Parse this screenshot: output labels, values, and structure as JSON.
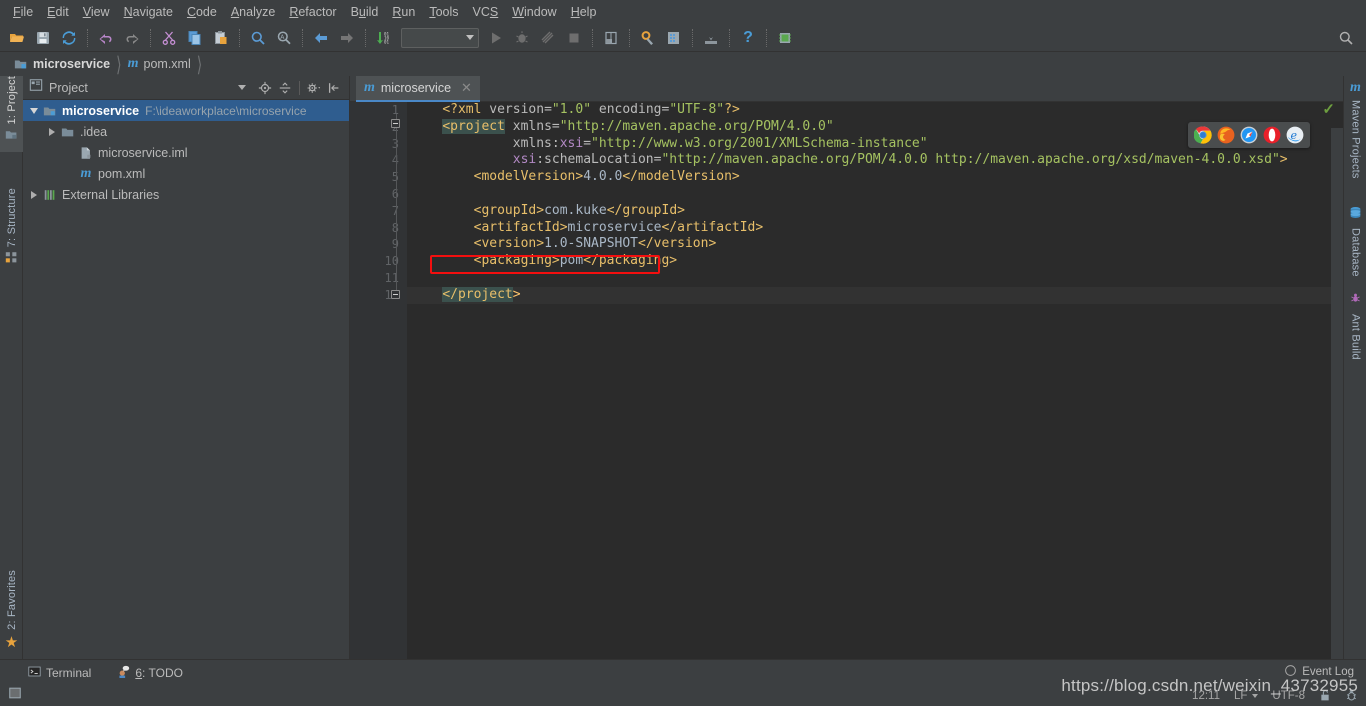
{
  "menubar": {
    "items": [
      {
        "label": "File",
        "mnemonic": "F"
      },
      {
        "label": "Edit",
        "mnemonic": "E"
      },
      {
        "label": "View",
        "mnemonic": "V"
      },
      {
        "label": "Navigate",
        "mnemonic": "N"
      },
      {
        "label": "Code",
        "mnemonic": "C"
      },
      {
        "label": "Analyze",
        "mnemonic": "A"
      },
      {
        "label": "Refactor",
        "mnemonic": "R"
      },
      {
        "label": "Build",
        "mnemonic": "u"
      },
      {
        "label": "Run",
        "mnemonic": "R"
      },
      {
        "label": "Tools",
        "mnemonic": "T"
      },
      {
        "label": "VCS",
        "mnemonic": "S"
      },
      {
        "label": "Window",
        "mnemonic": "W"
      },
      {
        "label": "Help",
        "mnemonic": "H"
      }
    ]
  },
  "toolbar": {
    "icons": [
      "open-folder-icon",
      "save-all-icon",
      "sync-refresh-icon",
      "undo-icon",
      "redo-icon",
      "cut-icon",
      "copy-icon",
      "paste-icon",
      "find-icon",
      "replace-icon",
      "back-icon",
      "forward-icon",
      "compile-icon"
    ],
    "run_config_value": "",
    "run_config_placeholder": "",
    "right_icons": [
      "run-icon",
      "debug-icon",
      "run-coverage-icon",
      "stop-icon",
      "project-structure-icon",
      "settings-icon",
      "maven-icon",
      "update-project-icon",
      "help-icon",
      "device-manager-icon"
    ],
    "search_icon": "search-everywhere-icon"
  },
  "navbar": {
    "crumbs": [
      {
        "label": "microservice",
        "icon": "module-icon"
      },
      {
        "label": "pom.xml",
        "icon": "maven-m-icon"
      }
    ]
  },
  "left_rail": {
    "items": [
      {
        "label": "1: Project",
        "mnemonic": "1",
        "icon": "project-icon",
        "active": true
      },
      {
        "label": "7: Structure",
        "mnemonic": "7",
        "icon": "structure-icon",
        "active": false
      }
    ],
    "bottom_items": [
      {
        "label": "2: Favorites",
        "mnemonic": "2",
        "icon": "star-icon",
        "active": false
      }
    ]
  },
  "right_rail": {
    "items": [
      {
        "label": "Maven Projects",
        "icon": "maven-m-icon"
      },
      {
        "label": "Database",
        "icon": "database-icon"
      },
      {
        "label": "Ant Build",
        "icon": "ant-icon"
      }
    ]
  },
  "project_panel": {
    "title": "Project",
    "view_icon": "project-view-icon",
    "tools": [
      "locate-target-icon",
      "collapse-all-icon",
      "settings-gear-icon",
      "hide-panel-icon"
    ],
    "tree": [
      {
        "label": "microservice",
        "sublabel": "F:\\ideaworkplace\\microservice",
        "icon": "module-icon",
        "expanded": true,
        "indent": 0,
        "bold": true,
        "selected": true,
        "has_arrow": true
      },
      {
        "label": ".idea",
        "sublabel": "",
        "icon": "folder-icon",
        "expanded": false,
        "indent": 1,
        "bold": false,
        "selected": false,
        "has_arrow": true
      },
      {
        "label": "microservice.iml",
        "sublabel": "",
        "icon": "iml-file-icon",
        "expanded": false,
        "indent": 2,
        "bold": false,
        "selected": false,
        "has_arrow": false
      },
      {
        "label": "pom.xml",
        "sublabel": "",
        "icon": "maven-m-icon",
        "expanded": false,
        "indent": 2,
        "bold": false,
        "selected": false,
        "has_arrow": false
      },
      {
        "label": "External Libraries",
        "sublabel": "",
        "icon": "libraries-icon",
        "expanded": false,
        "indent": 0,
        "bold": false,
        "selected": false,
        "has_arrow": true
      }
    ]
  },
  "editor": {
    "tab": {
      "label": "microservice",
      "icon": "maven-m-icon",
      "close_icon": "close-icon"
    },
    "inspection_status": "ok-check-icon",
    "line_count": 12,
    "lines": [
      {
        "n": 1,
        "segments": [
          {
            "t": "    ",
            "c": "tk-text"
          },
          {
            "t": "<?xml ",
            "c": "tk-pi"
          },
          {
            "t": "version=",
            "c": "tk-attr"
          },
          {
            "t": "\"1.0\"",
            "c": "tk-val"
          },
          {
            "t": " encoding=",
            "c": "tk-attr"
          },
          {
            "t": "\"UTF-8\"",
            "c": "tk-val"
          },
          {
            "t": "?>",
            "c": "tk-pi"
          }
        ]
      },
      {
        "n": 2,
        "segments": [
          {
            "t": "    ",
            "c": "tk-text"
          },
          {
            "t": "<project",
            "c": "tk-tag tk-hl"
          },
          {
            "t": " xmlns=",
            "c": "tk-attr"
          },
          {
            "t": "\"http://maven.apache.org/POM/4.0.0\"",
            "c": "tk-val"
          }
        ]
      },
      {
        "n": 3,
        "segments": [
          {
            "t": "             ",
            "c": "tk-text"
          },
          {
            "t": "xmlns:",
            "c": "tk-attr"
          },
          {
            "t": "xsi",
            "c": "tk-ns"
          },
          {
            "t": "=",
            "c": "tk-attr"
          },
          {
            "t": "\"http://www.w3.org/2001/XMLSchema-instance\"",
            "c": "tk-val"
          }
        ]
      },
      {
        "n": 4,
        "segments": [
          {
            "t": "             ",
            "c": "tk-text"
          },
          {
            "t": "xsi",
            "c": "tk-ns"
          },
          {
            "t": ":schemaLocation=",
            "c": "tk-attr"
          },
          {
            "t": "\"http://maven.apache.org/POM/4.0.0 http://maven.apache.org/xsd/maven-4.0.0.xsd\"",
            "c": "tk-val"
          },
          {
            "t": ">",
            "c": "tk-tag"
          }
        ]
      },
      {
        "n": 5,
        "segments": [
          {
            "t": "        ",
            "c": "tk-text"
          },
          {
            "t": "<modelVersion>",
            "c": "tk-tag"
          },
          {
            "t": "4.0.0",
            "c": "tk-text"
          },
          {
            "t": "</modelVersion>",
            "c": "tk-tag"
          }
        ]
      },
      {
        "n": 6,
        "segments": []
      },
      {
        "n": 7,
        "segments": [
          {
            "t": "        ",
            "c": "tk-text"
          },
          {
            "t": "<groupId>",
            "c": "tk-tag"
          },
          {
            "t": "com.kuke",
            "c": "tk-text"
          },
          {
            "t": "</groupId>",
            "c": "tk-tag"
          }
        ]
      },
      {
        "n": 8,
        "segments": [
          {
            "t": "        ",
            "c": "tk-text"
          },
          {
            "t": "<artifactId>",
            "c": "tk-tag"
          },
          {
            "t": "microservice",
            "c": "tk-text"
          },
          {
            "t": "</artifactId>",
            "c": "tk-tag"
          }
        ]
      },
      {
        "n": 9,
        "segments": [
          {
            "t": "        ",
            "c": "tk-text"
          },
          {
            "t": "<version>",
            "c": "tk-tag"
          },
          {
            "t": "1.0-SNAPSHOT",
            "c": "tk-text"
          },
          {
            "t": "</version>",
            "c": "tk-tag"
          }
        ]
      },
      {
        "n": 10,
        "segments": [
          {
            "t": "        ",
            "c": "tk-text"
          },
          {
            "t": "<packaging>",
            "c": "tk-tag"
          },
          {
            "t": "pom",
            "c": "tk-text"
          },
          {
            "t": "</packaging>",
            "c": "tk-tag"
          }
        ]
      },
      {
        "n": 11,
        "segments": []
      },
      {
        "n": 12,
        "segments": [
          {
            "t": "    ",
            "c": "tk-text"
          },
          {
            "t": "</project",
            "c": "tk-tag tk-hl"
          },
          {
            "t": ">",
            "c": "tk-brace"
          }
        ]
      }
    ],
    "annotation": {
      "type": "red-rectangle",
      "target_line": 10,
      "color": "#f40f0f"
    },
    "browser_popup": {
      "browsers": [
        "chrome-icon",
        "firefox-icon",
        "safari-icon",
        "opera-icon",
        "ie-icon"
      ]
    }
  },
  "bottom_bar": {
    "items": [
      {
        "label": "Terminal",
        "mnemonic": "",
        "icon": "terminal-icon"
      },
      {
        "label": "6: TODO",
        "mnemonic": "6",
        "icon": "todo-icon"
      }
    ]
  },
  "status_bar": {
    "left_icon": "toggle-toolbar-icon",
    "event_log": {
      "label": "Event Log",
      "icon": "event-log-icon"
    },
    "caret_position": "12:11",
    "line_separator": "LF",
    "encoding": "UTF-8",
    "lock_icon": "unlock-icon",
    "inspection_icon": "inspection-profile-icon",
    "watermark": "https://blog.csdn.net/weixin_43732955"
  },
  "colors": {
    "accent": "#4a88c7",
    "selection": "#2f5d8f",
    "annotation_red": "#f40f0f",
    "editor_bg": "#2b2b2b",
    "chrome_bg": "#3c3f41",
    "tag": "#e8bf6a",
    "value": "#a5c261",
    "text": "#a9b7c6"
  }
}
